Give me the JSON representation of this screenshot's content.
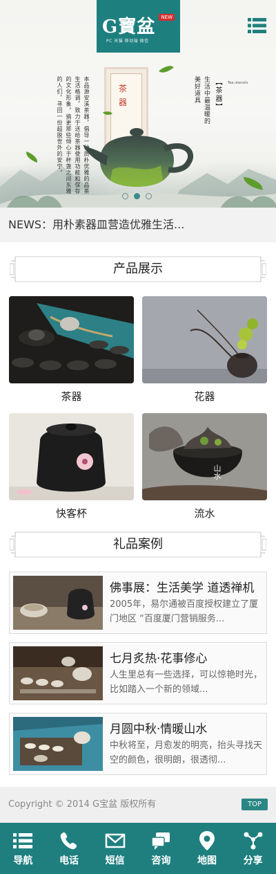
{
  "header": {
    "logo_text": "G寶盆",
    "logo_badge": "NEW",
    "logo_subtitle": "PC 天猫 移动端 微信"
  },
  "banner": {
    "panel_title": "茶器",
    "tag_title": "【茶器】",
    "tag_en": "Tea utensils",
    "right_text": "生活中最温暖的美好道具",
    "left_text": "本品源安溪茶器，倡导一种质朴优雅的品茶生活格调，致力于送给茶器使用功能和保存的文化形象。搞更那些倾心于杯盏之间东雅的人们，寻回一份超脱世外的安宁。",
    "slides": 3,
    "active_slide": 1
  },
  "news": {
    "text": "NEWS：用朴素器皿营造优雅生活..."
  },
  "products": {
    "heading": "产品展示",
    "items": [
      {
        "label": "茶器"
      },
      {
        "label": "花器"
      },
      {
        "label": "快客杯"
      },
      {
        "label": "流水"
      }
    ]
  },
  "cases": {
    "heading": "礼品案例",
    "items": [
      {
        "title": "佛事展：生活美学 道透禅机",
        "desc": "2005年，易尔通被百度授权建立了厦门地区 “百度厦门营销服务..."
      },
      {
        "title": "七月炙热·花事修心",
        "desc": "人生里总有一些选择，可以惊艳时光，比如踏入一个新的领域..."
      },
      {
        "title": "月圆中秋·情暖山水",
        "desc": "中秋将至，月愈发的明亮，抬头寻找天空的颜色，很明朗，很透彻..."
      }
    ]
  },
  "footer": {
    "copyright": "Copyright © 2014 G宝盆 版权所有",
    "top_label": "TOP"
  },
  "bottom_nav": {
    "items": [
      {
        "label": "导航",
        "icon": "list-icon"
      },
      {
        "label": "电话",
        "icon": "phone-icon"
      },
      {
        "label": "短信",
        "icon": "mail-icon"
      },
      {
        "label": "咨询",
        "icon": "chat-icon"
      },
      {
        "label": "地图",
        "icon": "map-pin-icon"
      },
      {
        "label": "分享",
        "icon": "share-icon"
      }
    ]
  },
  "colors": {
    "brand": "#1f7f7f",
    "accent_red": "#c33c2f"
  }
}
